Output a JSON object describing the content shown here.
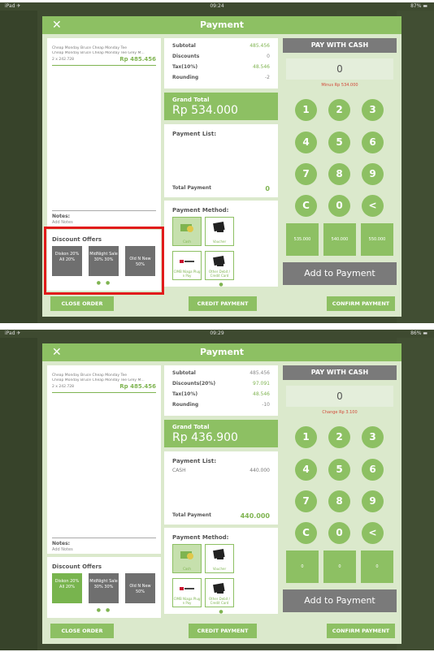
{
  "screens": [
    {
      "status": {
        "left": "iPad ✈",
        "time": "09:24",
        "battery": "87% ▬"
      },
      "header": {
        "close_icon": "close-icon",
        "title": "Payment"
      },
      "order": {
        "item_line1": "Cheap Monday Bruce Cheap Monday Tee",
        "item_line2": "Cheap Monday Bruce Cheap Monday Tee Grey M...",
        "qty": "2 x 242.728",
        "price": "Rp 485.456",
        "notes_label": "Notes:",
        "notes_value": "Add Notes"
      },
      "discounts": {
        "label": "Discount Offers",
        "items": [
          {
            "label": "Diskon 20% All 20%",
            "active": false
          },
          {
            "label": "MidNight Sale 30% 30%",
            "active": false
          },
          {
            "label": "Old N New 50%",
            "active": false
          }
        ],
        "dots": "● ●"
      },
      "summary": {
        "subtotal_label": "Subtotal",
        "subtotal": "485.456",
        "discounts_label": "Discounts",
        "discounts": "0",
        "tax_label": "Tax(10%)",
        "tax": "48.546",
        "rounding_label": "Rounding",
        "rounding": "-2",
        "grand_total_label": "Grand Total",
        "grand_total": "Rp 534.000"
      },
      "payment_list": {
        "label": "Payment List:",
        "method": "",
        "amount": "",
        "total_label": "Total Payment",
        "total": "0"
      },
      "payment_method": {
        "label": "Payment Method:",
        "options": [
          {
            "label": "Cash",
            "icon": "cash-icon"
          },
          {
            "label": "Voucher",
            "icon": "voucher-icon"
          },
          {
            "label": "CIMB Niaga Plug n Pay",
            "icon": "cimb-niaga-icon"
          },
          {
            "label": "Other Debit / Credit Card",
            "icon": "card-icon"
          }
        ],
        "dot": "●"
      },
      "cash": {
        "title": "PAY WITH CASH",
        "amount": "0",
        "note": "Minus Rp 534.000",
        "keys": [
          "1",
          "2",
          "3",
          "4",
          "5",
          "6",
          "7",
          "8",
          "9",
          "C",
          "0",
          "<"
        ],
        "quick": [
          "535.000",
          "540.000",
          "550.000"
        ],
        "add_label": "Add to Payment"
      },
      "footer": {
        "close": "CLOSE ORDER",
        "credit": "CREDIT PAYMENT",
        "confirm": "CONFIRM PAYMENT"
      }
    },
    {
      "status": {
        "left": "iPad ✈",
        "time": "09:29",
        "battery": "86% ▬"
      },
      "header": {
        "close_icon": "close-icon",
        "title": "Payment"
      },
      "order": {
        "item_line1": "Cheap Monday Bruce Cheap Monday Tee",
        "item_line2": "Cheap Monday Bruce Cheap Monday Tee Grey M...",
        "qty": "2 x 242.728",
        "price": "Rp 485.456",
        "notes_label": "Notes:",
        "notes_value": "Add Notes"
      },
      "discounts": {
        "label": "Discount Offers",
        "items": [
          {
            "label": "Diskon 20% All 20%",
            "active": true
          },
          {
            "label": "MidNight Sale 30% 30%",
            "active": false
          },
          {
            "label": "Old N New 50%",
            "active": false
          }
        ],
        "dots": "● ●"
      },
      "summary": {
        "subtotal_label": "Subtotal",
        "subtotal": "485.456",
        "discounts_label": "Discounts(20%)",
        "discounts": "97.091",
        "tax_label": "Tax(10%)",
        "tax": "48.546",
        "rounding_label": "Rounding",
        "rounding": "-10",
        "grand_total_label": "Grand Total",
        "grand_total": "Rp 436.900"
      },
      "payment_list": {
        "label": "Payment List:",
        "method": "CASH",
        "amount": "440.000",
        "total_label": "Total Payment",
        "total": "440.000"
      },
      "payment_method": {
        "label": "Payment Method:",
        "options": [
          {
            "label": "Cash",
            "icon": "cash-icon"
          },
          {
            "label": "Voucher",
            "icon": "voucher-icon"
          },
          {
            "label": "CIMB Niaga Plug n Pay",
            "icon": "cimb-niaga-icon"
          },
          {
            "label": "Other Debit / Credit Card",
            "icon": "card-icon"
          }
        ],
        "dot": "●"
      },
      "cash": {
        "title": "PAY WITH CASH",
        "amount": "0",
        "note": "Change Rp 3.100",
        "keys": [
          "1",
          "2",
          "3",
          "4",
          "5",
          "6",
          "7",
          "8",
          "9",
          "C",
          "0",
          "<"
        ],
        "quick": [
          "0",
          "0",
          "0"
        ],
        "add_label": "Add to Payment"
      },
      "footer": {
        "close": "CLOSE ORDER",
        "credit": "CREDIT PAYMENT",
        "confirm": "CONFIRM PAYMENT"
      }
    }
  ],
  "colors": {
    "accent": "#8dc063",
    "highlight": "#e11b1b",
    "gray_button": "#7a7a7a",
    "negative": "#d24a3a"
  }
}
